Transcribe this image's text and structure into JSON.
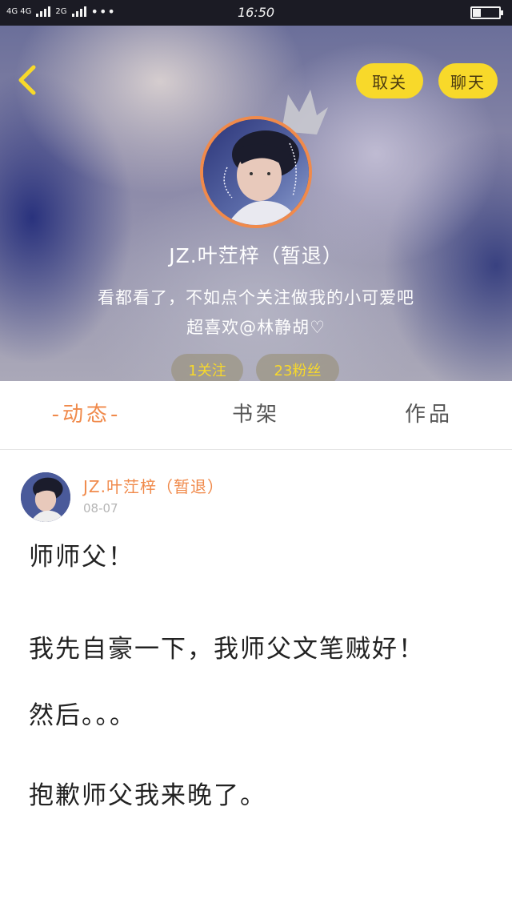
{
  "status_bar": {
    "network_label": "4G 4G",
    "network2_label": "2G",
    "more_dots": "•••",
    "time": "16:50"
  },
  "header": {
    "unfollow_label": "取关",
    "chat_label": "聊天"
  },
  "profile": {
    "name": "JZ.叶茳梓（暂退）",
    "bio_line1": "看都看了，不如点个关注做我的小可爱吧",
    "bio_line2": "超喜欢@林静胡♡",
    "following": "1关注",
    "fans": "23粉丝"
  },
  "tabs": {
    "feed": "-动态-",
    "shelf": "书架",
    "works": "作品"
  },
  "post": {
    "author": "JZ.叶茳梓（暂退）",
    "date": "08-07",
    "lines": [
      "师师父！",
      "我先自豪一下，我师父文笔贼好！",
      "然后。。。",
      "抱歉师父我来晚了。"
    ]
  },
  "colors": {
    "accent_orange": "#f08a4b",
    "button_yellow": "#f8d92a"
  }
}
